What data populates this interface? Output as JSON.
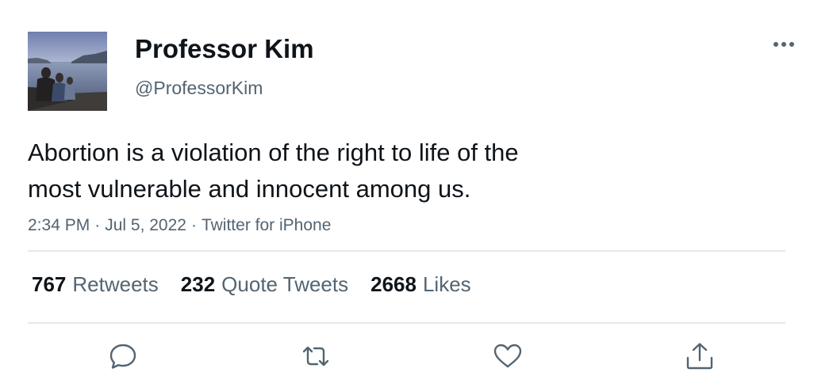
{
  "author": {
    "display_name": "Professor Kim",
    "handle": "@ProfessorKim",
    "avatar_icon": "profile-photo-lakeside"
  },
  "tweet": {
    "text_line1": "Abortion is a violation of the right to life of the",
    "text_line2": "most vulnerable and innocent among us.",
    "time": "2:34 PM",
    "separator": "·",
    "date": "Jul 5, 2022",
    "source": "Twitter for iPhone"
  },
  "stats": {
    "retweets_count": "767",
    "retweets_label": "Retweets",
    "quotes_count": "232",
    "quotes_label": "Quote Tweets",
    "likes_count": "2668",
    "likes_label": "Likes"
  },
  "actions": {
    "reply_icon": "reply-icon",
    "retweet_icon": "retweet-icon",
    "like_icon": "heart-icon",
    "share_icon": "share-icon",
    "more_icon": "more-icon"
  },
  "colors": {
    "primary_text": "#0f1419",
    "secondary_text": "#536471",
    "divider": "#e4e8eb",
    "background": "#ffffff"
  }
}
